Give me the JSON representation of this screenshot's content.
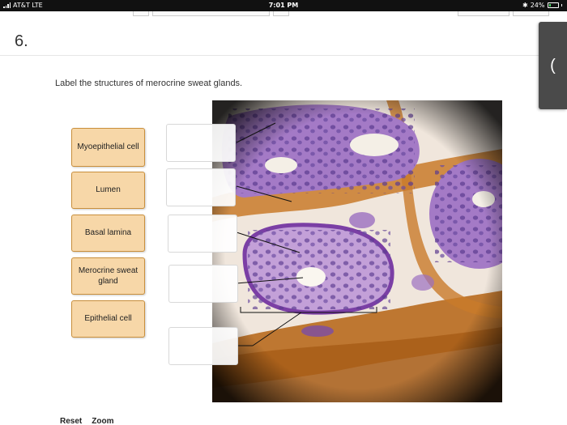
{
  "status": {
    "carrier": "AT&T  LTE",
    "time": "7:01 PM",
    "battery": "24%",
    "battery_level": 0.24
  },
  "question": {
    "number": "6.",
    "prompt": "Label the structures of merocrine sweat glands."
  },
  "side_tab_glyph": "(",
  "labels": [
    "Myoepithelial cell",
    "Lumen",
    "Basal lamina",
    "Merocrine sweat gland",
    "Epithelial cell"
  ],
  "controls": {
    "reset": "Reset",
    "zoom": "Zoom"
  },
  "colors": {
    "tile": "#f7d7a8",
    "tile_border": "#c98f3c",
    "connective": "#c97a2a",
    "cell": "#9b6fc1"
  },
  "icons": {
    "signal": "signal-bars-icon",
    "bluetooth": "bluetooth-icon",
    "battery": "battery-icon"
  }
}
